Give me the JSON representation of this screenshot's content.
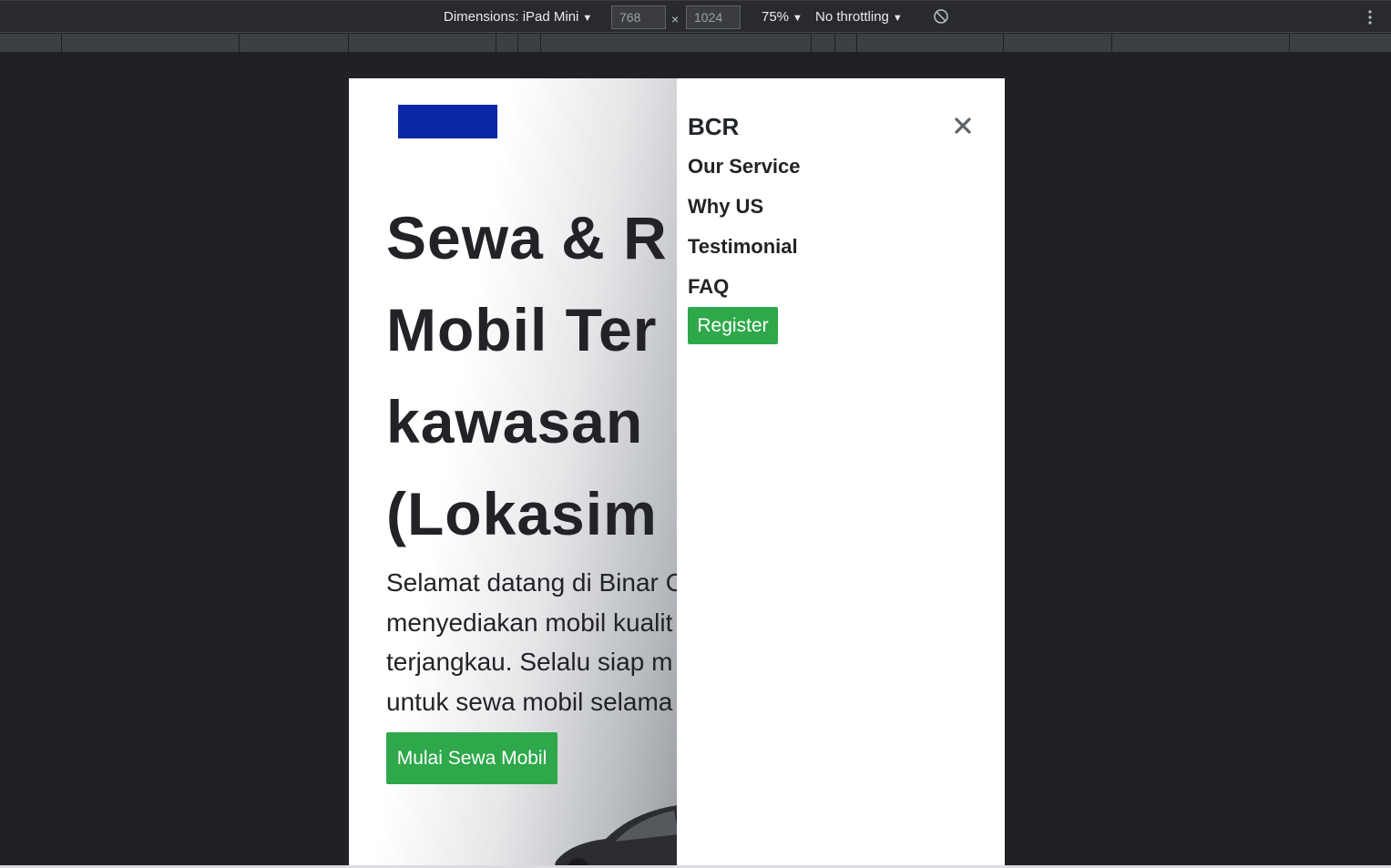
{
  "devtools": {
    "dimensions_label": "Dimensions: iPad Mini",
    "width_value": "768",
    "height_value": "1024",
    "times": "×",
    "zoom": "75%",
    "throttling": "No throttling",
    "icons": {
      "rotate": "rotate-icon",
      "more": "more-options-icon",
      "dropdown": "chevron-down-icon"
    }
  },
  "page": {
    "hero_title_lines": [
      "Sewa & R",
      "Mobil Ter",
      "kawasan",
      "(Lokasim"
    ],
    "hero_desc_lines": [
      "Selamat datang di Binar C",
      "menyediakan mobil kualit",
      "terjangkau. Selalu siap m",
      "untuk sewa mobil selama"
    ],
    "cta_label": "Mulai Sewa Mobil",
    "colors": {
      "brand_blue": "#0d28a6",
      "button_green": "#2ea84a",
      "text_dark": "#222326"
    }
  },
  "menu": {
    "brand": "BCR",
    "close": "close-icon",
    "items": [
      {
        "label": "Our Service"
      },
      {
        "label": "Why US"
      },
      {
        "label": "Testimonial"
      },
      {
        "label": "FAQ"
      }
    ],
    "register_label": "Register"
  }
}
